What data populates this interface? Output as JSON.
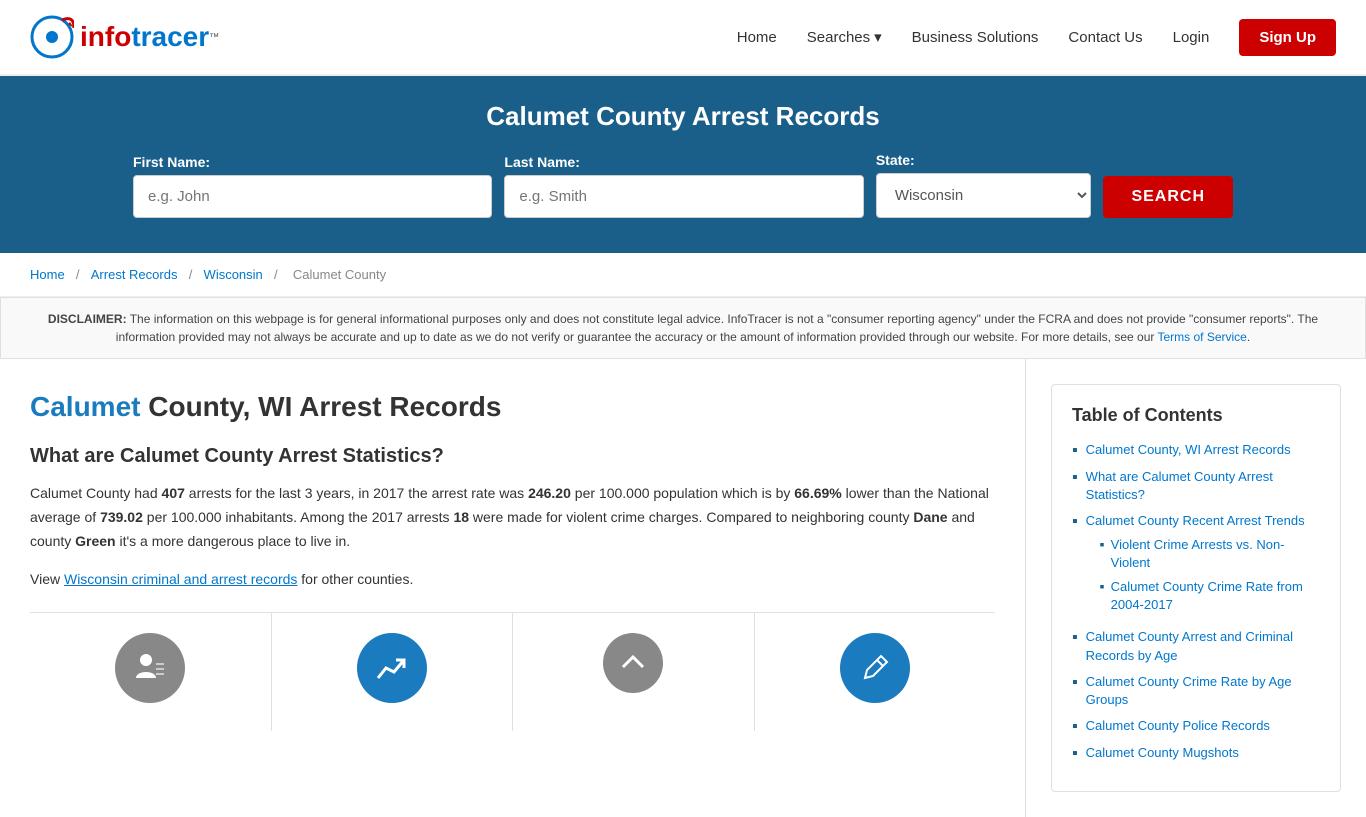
{
  "header": {
    "logo_info": "InfoTracer",
    "logo_tm": "™",
    "nav": {
      "home": "Home",
      "searches": "Searches",
      "business_solutions": "Business Solutions",
      "contact_us": "Contact Us",
      "login": "Login",
      "signup": "Sign Up"
    }
  },
  "hero": {
    "title": "Calumet County Arrest Records",
    "first_name_label": "First Name:",
    "first_name_placeholder": "e.g. John",
    "last_name_label": "Last Name:",
    "last_name_placeholder": "e.g. Smith",
    "state_label": "State:",
    "state_value": "Wisconsin",
    "search_btn": "SEARCH"
  },
  "breadcrumb": {
    "home": "Home",
    "arrest_records": "Arrest Records",
    "wisconsin": "Wisconsin",
    "calumet_county": "Calumet County"
  },
  "disclaimer": {
    "prefix": "DISCLAIMER:",
    "text": " The information on this webpage is for general informational purposes only and does not constitute legal advice. InfoTracer is not a \"consumer reporting agency\" under the FCRA and does not provide \"consumer reports\". The information provided may not always be accurate and up to date as we do not verify or guarantee the accuracy or the amount of information provided through our website. For more details, see our ",
    "link_text": "Terms of Service",
    "suffix": "."
  },
  "article": {
    "title_highlight": "Calumet",
    "title_rest": " County, WI Arrest Records",
    "section1_title": "What are Calumet County Arrest Statistics?",
    "paragraph1_before": "Calumet County had ",
    "arrests": "407",
    "paragraph1_mid1": " arrests for the last 3 years, in 2017 the arrest rate was ",
    "rate1": "246.20",
    "paragraph1_mid2": " per 100.000 population which is by ",
    "percent": "66.69%",
    "paragraph1_mid3": " lower than the National average of ",
    "rate2": "739.02",
    "paragraph1_mid4": " per 100.000 inhabitants. Among the 2017 arrests ",
    "violent": "18",
    "paragraph1_mid5": " were made for violent crime charges. Compared to neighboring county ",
    "county1": "Dane",
    "paragraph1_mid6": " and county ",
    "county2": "Green",
    "paragraph1_end": " it's a more dangerous place to live in.",
    "view_prefix": "View ",
    "view_link": "Wisconsin criminal and arrest records",
    "view_suffix": " for other counties."
  },
  "toc": {
    "title": "Table of Contents",
    "items": [
      {
        "label": "Calumet County, WI Arrest Records",
        "href": "#"
      },
      {
        "label": "What are Calumet County Arrest Statistics?",
        "href": "#",
        "subitems": []
      },
      {
        "label": "Calumet County Recent Arrest Trends",
        "href": "#",
        "subitems": [
          {
            "label": "Violent Crime Arrests vs. Non-Violent",
            "href": "#"
          },
          {
            "label": "Calumet County Crime Rate from 2004-2017",
            "href": "#"
          }
        ]
      },
      {
        "label": "Calumet County Arrest and Criminal Records by Age",
        "href": "#"
      },
      {
        "label": "Calumet County Crime Rate by Age Groups",
        "href": "#"
      },
      {
        "label": "Calumet County Police Records",
        "href": "#"
      },
      {
        "label": "Calumet County Mugshots",
        "href": "#"
      }
    ]
  }
}
